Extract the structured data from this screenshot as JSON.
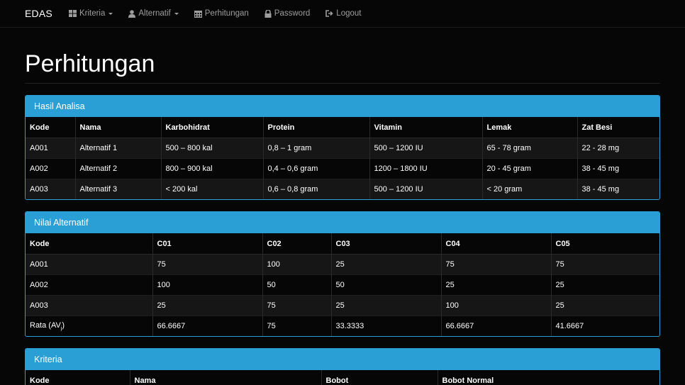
{
  "navbar": {
    "brand": "EDAS",
    "items": [
      {
        "label": "Kriteria",
        "icon": "grid-icon",
        "dropdown": true
      },
      {
        "label": "Alternatif",
        "icon": "user-icon",
        "dropdown": true
      },
      {
        "label": "Perhitungan",
        "icon": "calendar-icon",
        "dropdown": false
      },
      {
        "label": "Password",
        "icon": "lock-icon",
        "dropdown": false
      },
      {
        "label": "Logout",
        "icon": "logout-icon",
        "dropdown": false
      }
    ]
  },
  "page": {
    "title": "Perhitungan"
  },
  "hasil_analisa": {
    "title": "Hasil Analisa",
    "headers": [
      "Kode",
      "Nama",
      "Karbohidrat",
      "Protein",
      "Vitamin",
      "Lemak",
      "Zat Besi"
    ],
    "rows": [
      [
        "A001",
        "Alternatif 1",
        "500 – 800 kal",
        "0,8 – 1 gram",
        "500 – 1200 IU",
        "65 - 78 gram",
        "22 - 28 mg"
      ],
      [
        "A002",
        "Alternatif 2",
        "800 – 900 kal",
        "0,4 – 0,6 gram",
        "1200 – 1800 IU",
        "20 - 45 gram",
        "38 - 45 mg"
      ],
      [
        "A003",
        "Alternatif 3",
        "< 200 kal",
        "0,6 – 0,8 gram",
        "500 – 1200 IU",
        "< 20 gram",
        "38 - 45 mg"
      ]
    ]
  },
  "nilai_alternatif": {
    "title": "Nilai Alternatif",
    "headers": [
      "Kode",
      "C01",
      "C02",
      "C03",
      "C04",
      "C05"
    ],
    "rows": [
      [
        "A001",
        "75",
        "100",
        "25",
        "75",
        "75"
      ],
      [
        "A002",
        "100",
        "50",
        "50",
        "25",
        "25"
      ],
      [
        "A003",
        "25",
        "75",
        "25",
        "100",
        "25"
      ]
    ],
    "average": {
      "label": "Rata (AV",
      "label_sub": "j",
      "label_close": ")",
      "values": [
        "66.6667",
        "75",
        "33.3333",
        "66.6667",
        "41.6667"
      ]
    }
  },
  "kriteria": {
    "title": "Kriteria",
    "headers": [
      "Kode",
      "Nama",
      "Bobot",
      "Bobot Normal"
    ]
  },
  "colors": {
    "primary": "#2a9fd6",
    "background": "#060606",
    "nav_text": "#9d9d9d"
  }
}
